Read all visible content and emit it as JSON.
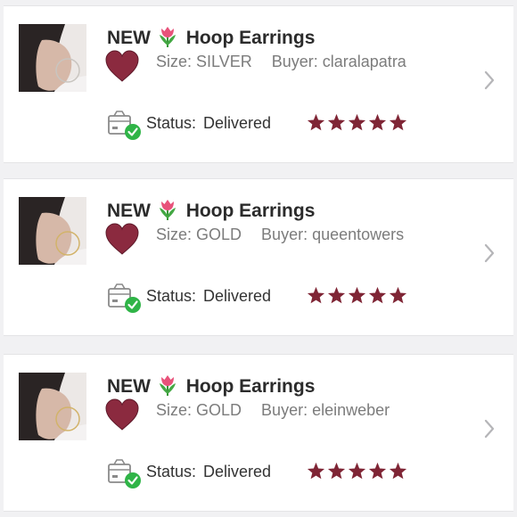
{
  "colors": {
    "heart": "#8b2a3f",
    "star": "#7f2535",
    "check": "#2fb447",
    "title": "#2b2b2b",
    "meta": "#7c7c7c"
  },
  "labels": {
    "size": "Size:",
    "buyer": "Buyer:",
    "status": "Status:"
  },
  "orders": [
    {
      "title": "NEW",
      "title_emoji": "tulip-icon",
      "product": "Hoop Earrings",
      "size": "SILVER",
      "buyer": "claralapatra",
      "status": "Delivered",
      "rating": 5
    },
    {
      "title": "NEW",
      "title_emoji": "tulip-icon",
      "product": "Hoop Earrings",
      "size": "GOLD",
      "buyer": "queentowers",
      "status": "Delivered",
      "rating": 5
    },
    {
      "title": "NEW",
      "title_emoji": "tulip-icon",
      "product": "Hoop Earrings",
      "size": "GOLD",
      "buyer": "eleinweber",
      "status": "Delivered",
      "rating": 5
    }
  ]
}
